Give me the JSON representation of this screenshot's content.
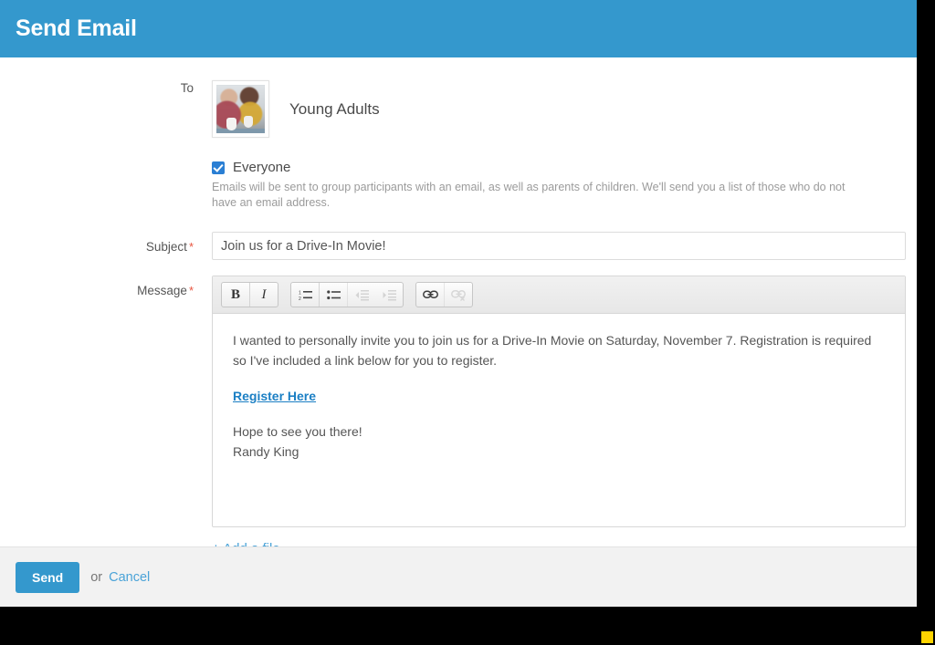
{
  "header": {
    "title": "Send Email"
  },
  "form": {
    "to": {
      "label": "To",
      "thumbnail_icon": "group-photo-thumbnail",
      "recipient_name": "Young Adults"
    },
    "everyone": {
      "checkbox_label": "Everyone",
      "checked": true,
      "help_text": "Emails will be sent to group participants with an email, as well as parents of children. We'll send you a list of those who do not have an email address."
    },
    "subject": {
      "label": "Subject",
      "required_marker": "*",
      "value": "Join us for a Drive-In Movie!",
      "placeholder": ""
    },
    "message": {
      "label": "Message",
      "required_marker": "*",
      "toolbar": [
        {
          "name": "bold-icon",
          "glyph": "B",
          "enabled": true
        },
        {
          "name": "italic-icon",
          "glyph": "I",
          "enabled": true
        },
        {
          "name": "ordered-list-icon",
          "glyph": "",
          "enabled": true
        },
        {
          "name": "unordered-list-icon",
          "glyph": "",
          "enabled": true
        },
        {
          "name": "outdent-icon",
          "glyph": "",
          "enabled": false
        },
        {
          "name": "indent-icon",
          "glyph": "",
          "enabled": false
        },
        {
          "name": "link-icon",
          "glyph": "",
          "enabled": true
        },
        {
          "name": "unlink-icon",
          "glyph": "",
          "enabled": false
        }
      ],
      "body": {
        "paragraph_1": "I wanted to personally invite you to join us for a Drive-In Movie on Saturday, November 7. Registration is required so I've included a link below for you to register.",
        "link_text": "Register Here",
        "closing_line_1": "Hope to see you there!",
        "closing_line_2": "Randy King"
      }
    },
    "add_file_label": "+ Add a file"
  },
  "footer": {
    "send_label": "Send",
    "or_label": "or",
    "cancel_label": "Cancel"
  },
  "colors": {
    "brand_blue": "#3498cd",
    "link_blue": "#4aa3d8",
    "body_link_blue": "#1b7fc4",
    "required_red": "#e8543f",
    "footer_gray": "#f2f2f2",
    "corner_marker": "#ffd400"
  }
}
